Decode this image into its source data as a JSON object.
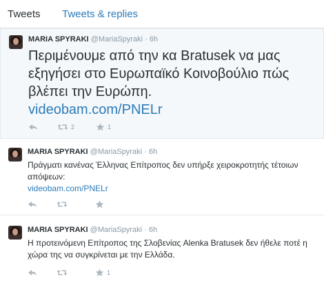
{
  "tabs": [
    {
      "label": "Tweets"
    },
    {
      "label": "Tweets & replies"
    }
  ],
  "colors": {
    "link": "#2b7bb9",
    "muted": "#8899a6",
    "text": "#292f33"
  },
  "tweets": [
    {
      "name": "MARIA SPYRAKI",
      "handle": "@MariaSpyraki",
      "dot": "·",
      "time": "6h",
      "text": "Περιμένουμε από την κα Bratusek να μας εξηγήσει στο Ευρωπαϊκό Κοινοβούλιο πώς βλέπει την Ευρώπη.",
      "link": "videobam.com/PNELr",
      "retweets": "2",
      "favorites": "1"
    },
    {
      "name": "MARIA SPYRAKI",
      "handle": "@MariaSpyraki",
      "dot": "·",
      "time": "6h",
      "text": "Πράγματι κανένας Έλληνας Επίτροπος δεν υπήρξε χειροκροτητής τέτοιων απόψεων:",
      "link": "videobam.com/PNELr",
      "retweets": "",
      "favorites": ""
    },
    {
      "name": "MARIA SPYRAKI",
      "handle": "@MariaSpyraki",
      "dot": "·",
      "time": "6h",
      "text": "Η προτεινόμενη Επίτροπος της Σλοβενίας Alenka Bratusek δεν ήθελε ποτέ η χώρα της να συγκρίνεται με την Ελλάδα.",
      "link": "",
      "retweets": "",
      "favorites": "1"
    }
  ]
}
